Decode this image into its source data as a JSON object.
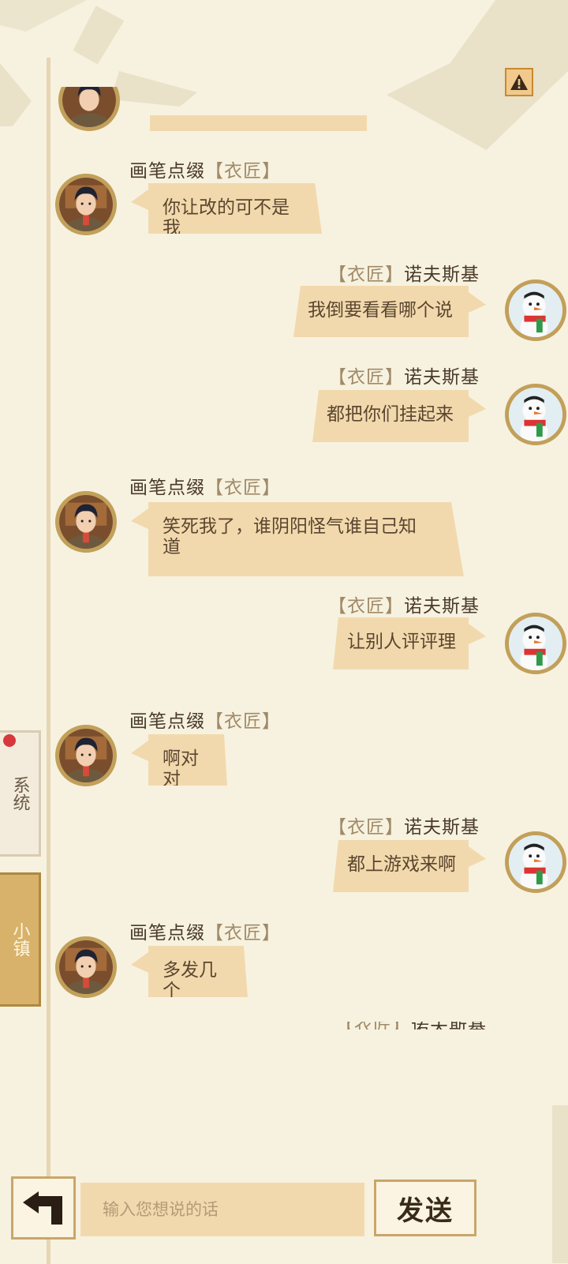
{
  "header": {
    "report_icon": "warning-triangle-icon"
  },
  "sides": {
    "left_name": "画笔点缀",
    "right_name": "诺夫斯基",
    "left_tag": "【衣匠】",
    "right_tag": "【衣匠】"
  },
  "messages": [
    {
      "text": "你让改的可不是我"
    },
    {
      "text": "我倒要看看哪个说"
    },
    {
      "text": "都把你们挂起来"
    },
    {
      "text": "笑死我了，谁阴阳怪气谁自己知道"
    },
    {
      "text": "让别人评评理"
    },
    {
      "text": "啊对对"
    },
    {
      "text": "都上游戏来啊"
    },
    {
      "text": "多发几个"
    }
  ],
  "side_tabs": {
    "system": "系统",
    "town": "小镇"
  },
  "input": {
    "placeholder": "输入您想说的话",
    "value": ""
  },
  "send_label": "发送"
}
